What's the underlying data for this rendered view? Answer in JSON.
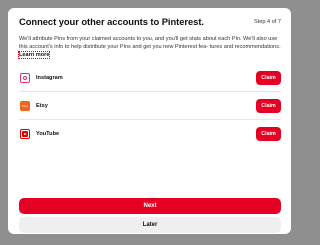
{
  "modal": {
    "title": "Connect your other accounts to Pinterest.",
    "step": "Step 4 of 7",
    "description": "We'll attribute Pins from your claimed accounts to you, and you'll get stats about each Pin. We'll also use this account's info to help distribute your Pins and get you new Pinterest fea- tures and recommendations.",
    "learn_more": "Learn more"
  },
  "accounts": [
    {
      "name": "Instagram",
      "icon": "instagram-icon",
      "claim_label": "Claim"
    },
    {
      "name": "Etsy",
      "icon": "etsy-icon",
      "icon_text": "Etsy",
      "claim_label": "Claim"
    },
    {
      "name": "YouTube",
      "icon": "youtube-icon",
      "claim_label": "Claim"
    }
  ],
  "footer": {
    "next_label": "Next",
    "later_label": "Later"
  },
  "colors": {
    "accent": "#e60023",
    "backdrop": "#8f8f8f",
    "secondary_button": "#efefef"
  }
}
